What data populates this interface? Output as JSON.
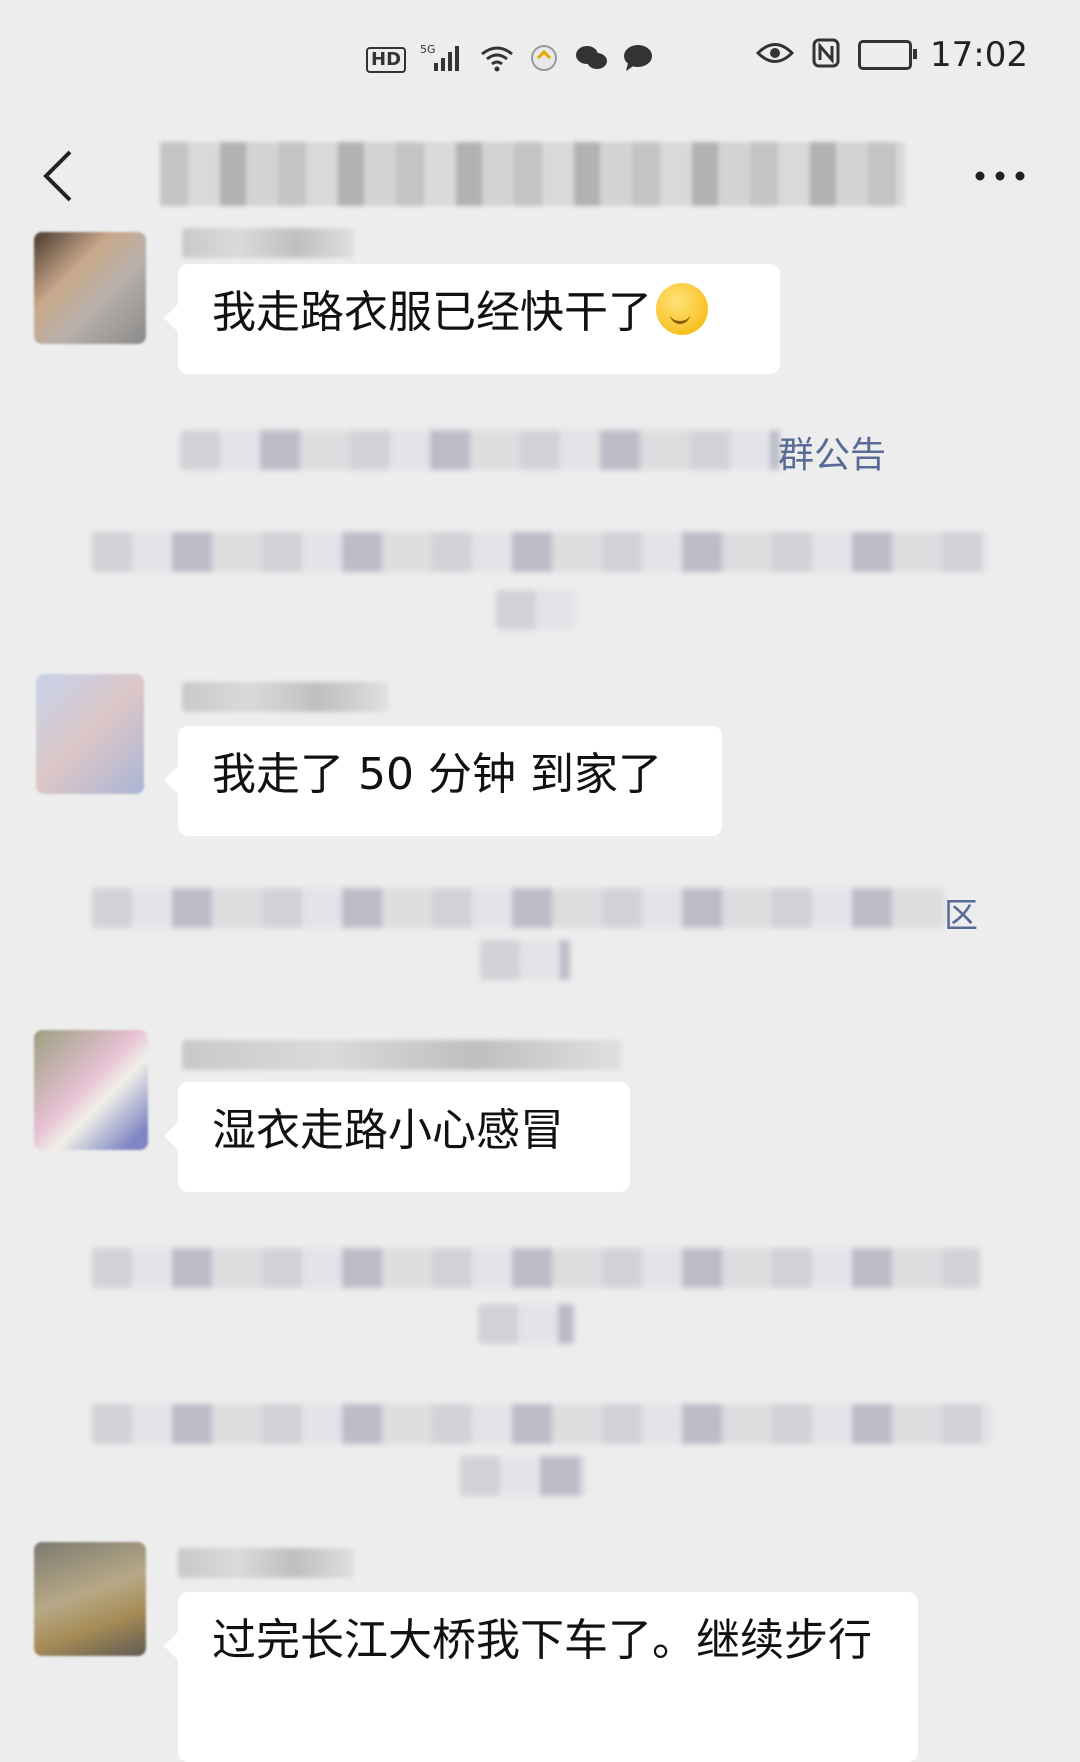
{
  "status_bar": {
    "network": "5G",
    "hd": "HD",
    "time": "17:02"
  },
  "messages": [
    {
      "text": "我走路衣服已经快干了"
    },
    {
      "text": "我走了 50 分钟  到家了"
    },
    {
      "text": "湿衣走路小心感冒"
    },
    {
      "text": "过完长江大桥我下车了。继续步行"
    }
  ],
  "system_notices": {
    "announcement_link": "群公告",
    "fragment_region": "区"
  },
  "icons": {
    "back": "chevron-left-icon",
    "more": "more-dots-icon",
    "emoji": "thinking-face-icon"
  }
}
